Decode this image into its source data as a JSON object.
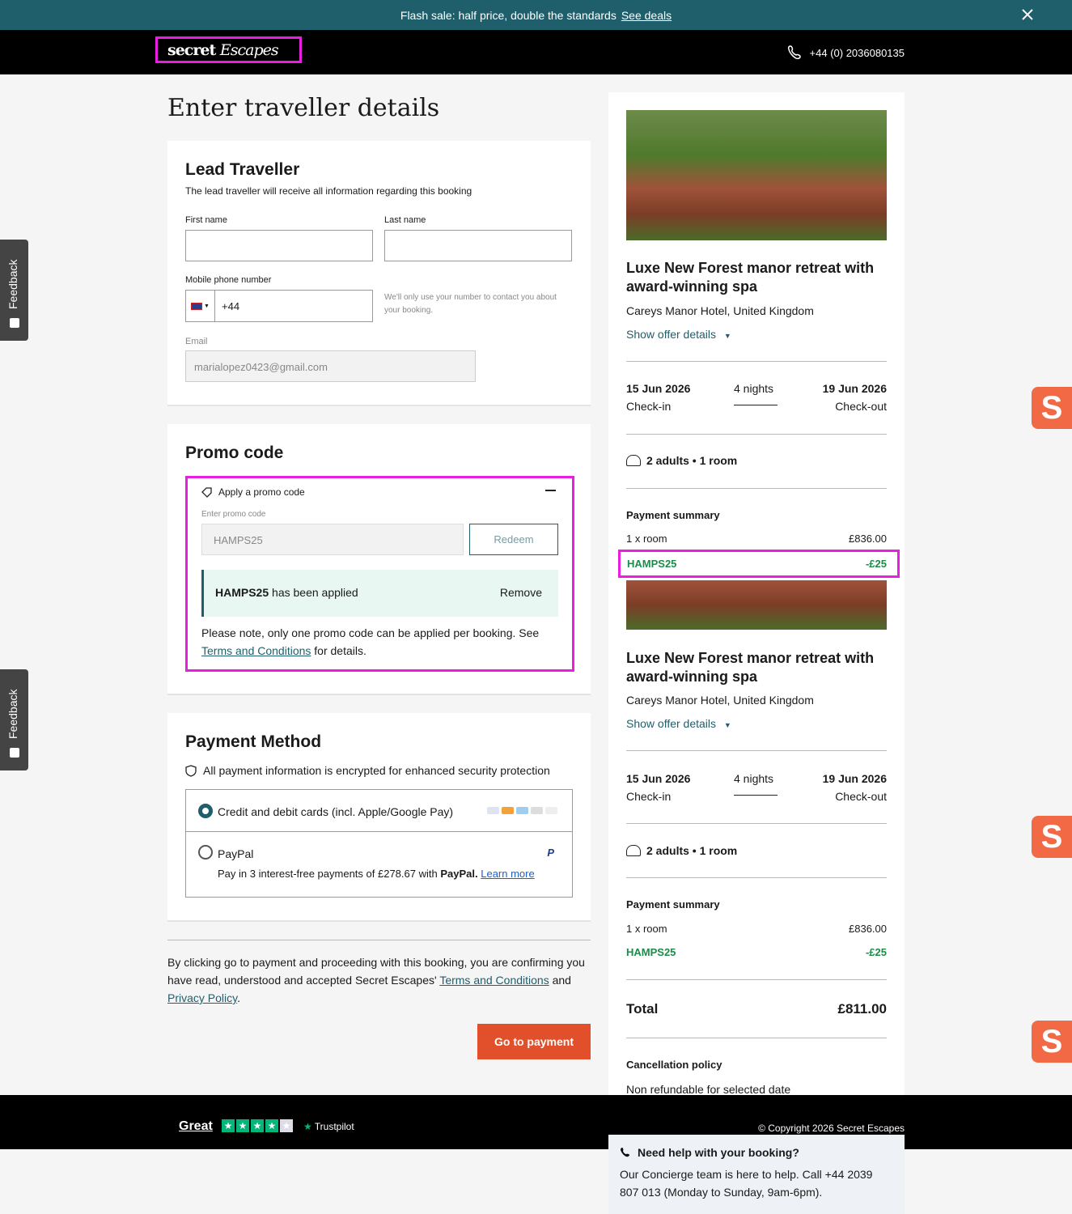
{
  "banner": {
    "text": "Flash sale: half price, double the standards",
    "link": "See deals"
  },
  "header": {
    "logo": "secret Escapes",
    "phone": "+44 (0) 2036080135"
  },
  "page_title": "Enter traveller details",
  "feedback_label": "Feedback",
  "lead": {
    "title": "Lead Traveller",
    "subtitle": "The lead traveller will receive all information regarding this booking",
    "first_name_label": "First name",
    "last_name_label": "Last name",
    "phone_label": "Mobile phone number",
    "phone_code": "+44",
    "phone_note": "We'll only use your number to contact you about your booking.",
    "email_label": "Email",
    "email_value": "marialopez0423@gmail.com"
  },
  "promo": {
    "title": "Promo code",
    "toggle": "Apply a promo code",
    "input_label": "Enter promo code",
    "input_value": "HAMPS25",
    "redeem": "Redeem",
    "applied_code": "HAMPS25",
    "applied_text": "has been applied",
    "remove": "Remove",
    "note_pre": "Please note, only one promo code can be applied per booking. See",
    "note_link": "Terms and Conditions",
    "note_post": "for details."
  },
  "payment": {
    "title": "Payment Method",
    "secure": "All payment information is encrypted for enhanced security protection",
    "card_option": "Credit and debit cards (incl. Apple/Google Pay)",
    "paypal_option": "PayPal",
    "paypal_note_pre": "Pay in 3 interest-free payments of £278.67 with",
    "paypal_bold": "PayPal.",
    "paypal_link": "Learn more"
  },
  "consent": {
    "pre": "By clicking go to payment and proceeding with this booking, you are confirming you have read, understood and accepted Secret Escapes'",
    "link1": "Terms and Conditions",
    "mid": "and",
    "link2": "Privacy Policy",
    "end": "."
  },
  "go_to_payment": "Go to payment",
  "summary": {
    "hotel_title": "Luxe New Forest manor retreat with award-winning spa",
    "location": "Careys Manor Hotel, United Kingdom",
    "show_details": "Show offer details",
    "checkin_date": "15 Jun 2026",
    "checkin_label": "Check-in",
    "nights": "4 nights",
    "checkout_date": "19 Jun 2026",
    "checkout_label": "Check-out",
    "guests": "2 adults • 1 room",
    "payment_summary": "Payment summary",
    "room_line": "1 x room",
    "room_price": "£836.00",
    "promo_code": "HAMPS25",
    "promo_discount": "-£25",
    "total_label": "Total",
    "total_value": "£811.00",
    "cancel_title": "Cancellation policy",
    "cancel_text": "Non refundable for selected date"
  },
  "footer": {
    "rating": "Great",
    "trustpilot": "Trustpilot",
    "copyright": "© Copyright 2026 Secret Escapes"
  },
  "help": {
    "title": "Need help with your booking?",
    "text": "Our Concierge team is here to help. Call +44 2039 807 013 (Monday to Sunday, 9am-6pm)."
  },
  "colors": {
    "brand": "#1f5e6b",
    "cta": "#e1502a",
    "highlight": "#e91ee0",
    "discount": "#1e8b4a"
  }
}
